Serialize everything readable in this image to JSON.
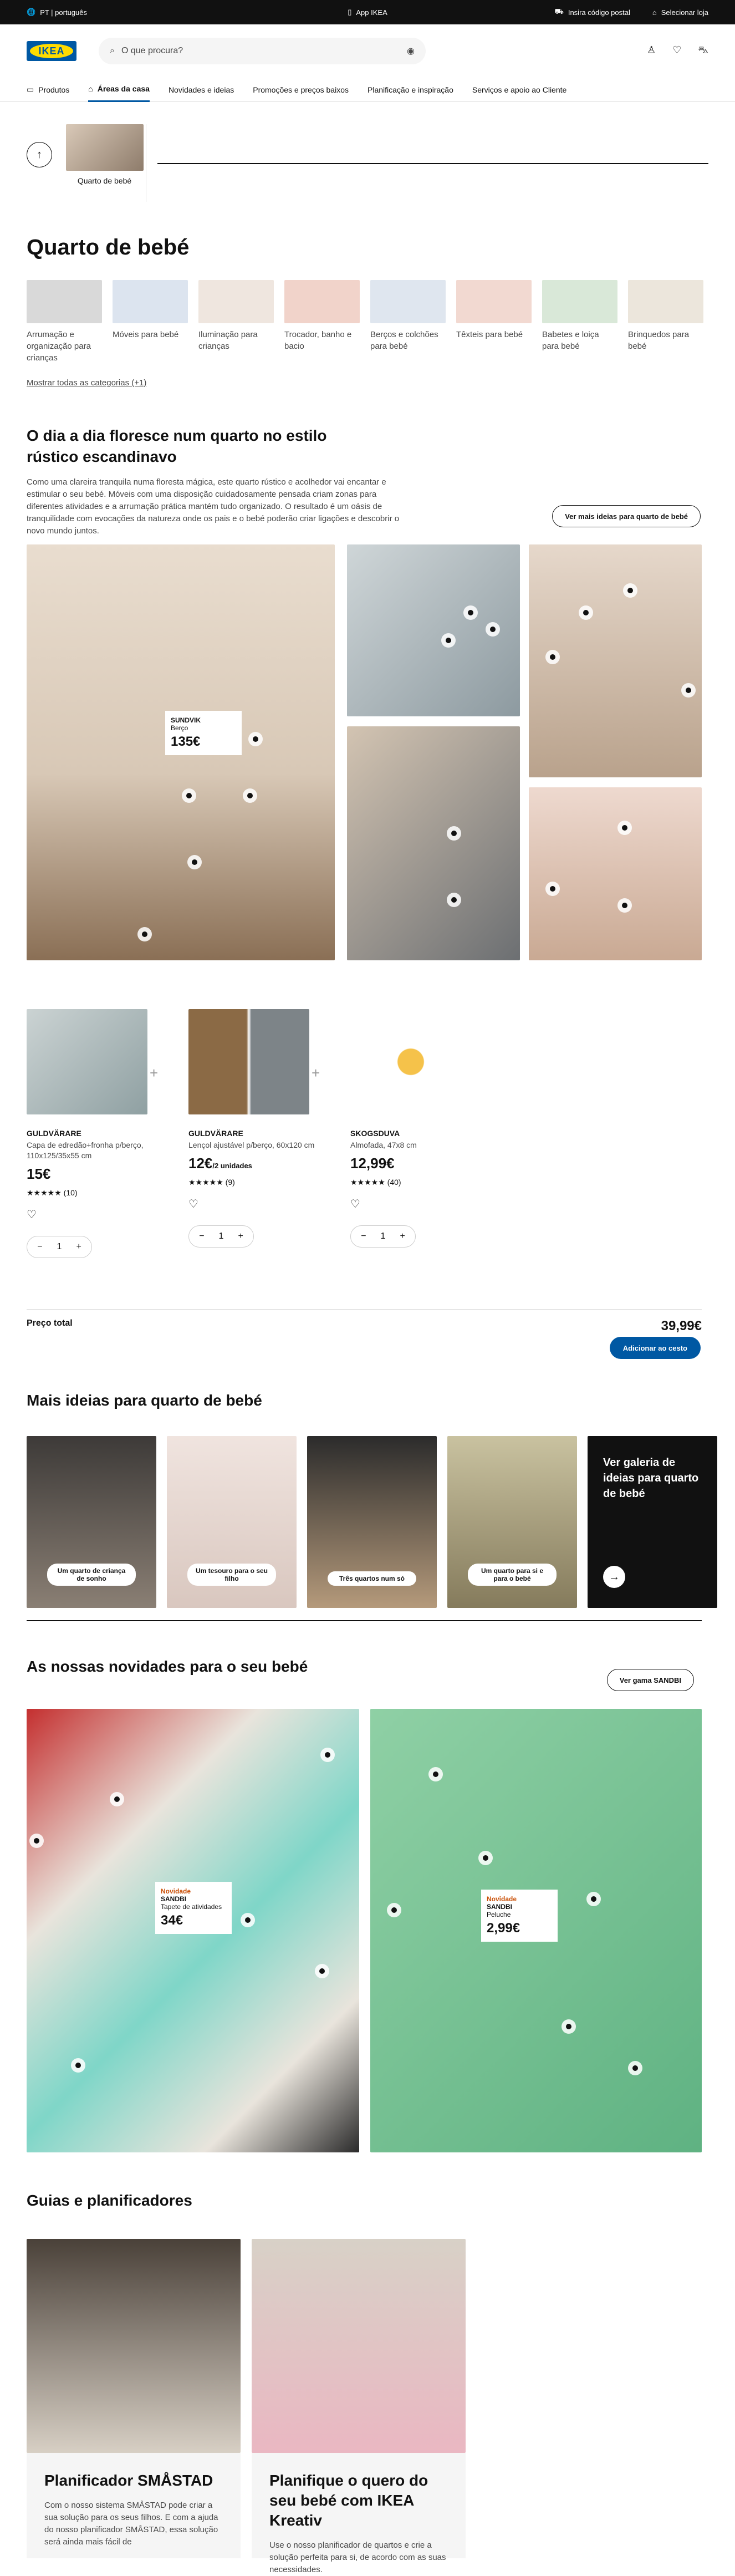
{
  "topbar": {
    "lang": "PT | português",
    "app": "App IKEA",
    "postal": "Insira código postal",
    "store": "Selecionar loja"
  },
  "header": {
    "logo": "IKEA",
    "search_placeholder": "O que procura?"
  },
  "nav": {
    "items": [
      "Produtos",
      "Áreas da casa",
      "Novidades e ideias",
      "Promoções e preços baixos",
      "Planificação e inspiração",
      "Serviços e apoio ao Cliente"
    ]
  },
  "breadcrumb": {
    "card_label": "Quarto de bebé"
  },
  "page_title": "Quarto de bebé",
  "categories": [
    {
      "label": "Arrumação e organização para crianças",
      "color": "#d9d9d9"
    },
    {
      "label": "Móveis para bebé",
      "color": "#dce4ef"
    },
    {
      "label": "Iluminação para crianças",
      "color": "#efe6df"
    },
    {
      "label": "Trocador, banho e bacio",
      "color": "#f1d3ca"
    },
    {
      "label": "Berços e colchões para bebé",
      "color": "#dfe6ef"
    },
    {
      "label": "Têxteis para bebé",
      "color": "#f2d9d1"
    },
    {
      "label": "Babetes e loiça para bebé",
      "color": "#d9e8d8"
    },
    {
      "label": "Brinquedos para bebé",
      "color": "#ece6dc"
    }
  ],
  "show_all": "Mostrar todas as categorias (+1)",
  "ideas": {
    "title": "O dia a dia floresce num quarto no estilo rústico escandinavo",
    "text": "Como uma clareira tranquila numa floresta mágica, este quarto rústico e acolhedor vai encantar e estimular o seu bebé. Móveis com uma disposição cuidadosamente pensada criam zonas para diferentes atividades e a arrumação prática mantém tudo organizado. O resultado é um oásis de tranquilidade com evocações da natureza onde os pais e o bebé poderão criar ligações e descobrir o novo mundo juntos.",
    "button": "Ver mais ideias para quarto de bebé",
    "tag": {
      "name": "SUNDVIK",
      "desc": "Berço",
      "price": "135€"
    }
  },
  "products": [
    {
      "name": "GULDVÄRARE",
      "desc": "Capa de edredão+fronha p/berço, 110x125/35x55 cm",
      "price": "15€",
      "unit": "",
      "rating": "★★★★★",
      "reviews": "(10)",
      "qty": "1"
    },
    {
      "name": "GULDVÄRARE",
      "desc": "Lençol ajustável p/berço, 60x120 cm",
      "price": "12€",
      "unit": "/2 unidades",
      "rating": "★★★★★",
      "reviews": "(9)",
      "qty": "1"
    },
    {
      "name": "SKOGSDUVA",
      "desc": "Almofada, 47x8 cm",
      "price": "12,99€",
      "unit": "",
      "rating": "★★★★★",
      "reviews": "(40)",
      "qty": "1"
    }
  ],
  "total": {
    "label": "Preço total",
    "amount": "39,99€",
    "button": "Adicionar ao cesto"
  },
  "more_ideas": {
    "title": "Mais ideias para quarto de bebé",
    "cards": [
      "Um quarto de criança de sonho",
      "Um tesouro para o seu filho",
      "Três quartos num só",
      "Um quarto para si e para o bebé"
    ],
    "gallery_link": "Ver galeria de ideias para quarto de bebé"
  },
  "news": {
    "title": "As nossas novidades para o seu bebé",
    "button": "Ver gama SANDBI",
    "tag1": {
      "badge": "Novidade",
      "name": "SANDBI",
      "desc": "Tapete de atividades",
      "price": "34€"
    },
    "tag2": {
      "badge": "Novidade",
      "name": "SANDBI",
      "desc": "Peluche",
      "price": "2,99€"
    }
  },
  "guides": {
    "title": "Guias e planificadores",
    "cards": [
      {
        "title": "Planificador SMÅSTAD",
        "text": "Com o nosso sistema SMÅSTAD pode criar a sua solução para os seus filhos. E com a ajuda do nosso planificador SMÅSTAD, essa solução será ainda mais fácil de"
      },
      {
        "title": "Planifique o quero do seu bebé com IKEA Kreativ",
        "text": "Use o nosso planificador de quartos e crie a solução perfeita para si, de acordo com as suas necessidades."
      }
    ]
  }
}
